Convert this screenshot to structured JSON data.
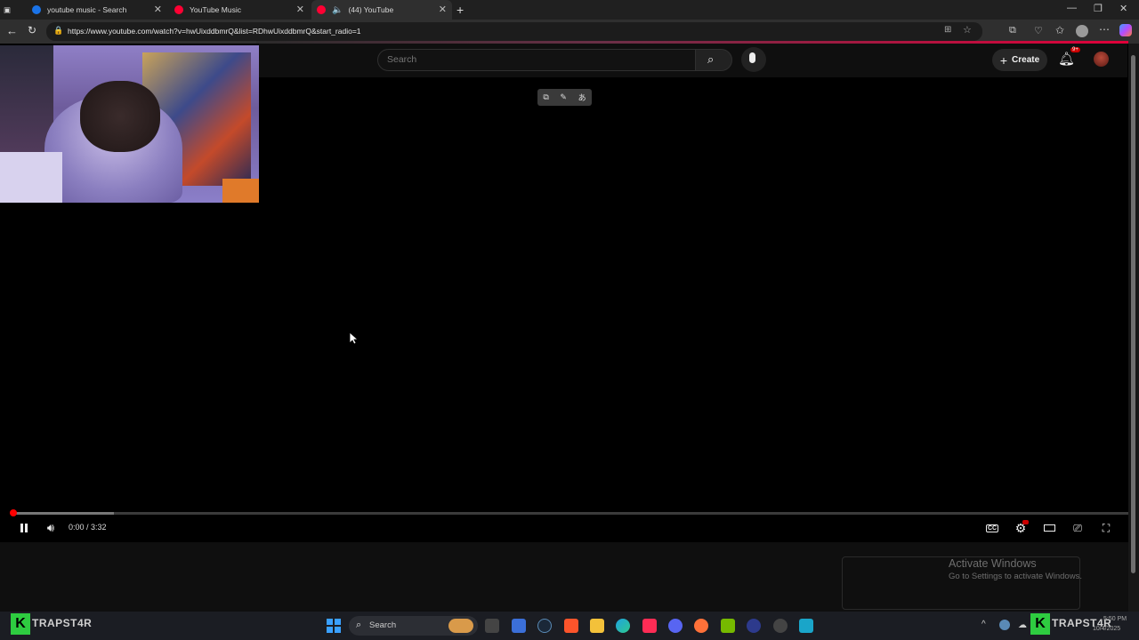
{
  "browser": {
    "tabs": [
      {
        "title": "youtube music - Search"
      },
      {
        "title": "YouTube Music"
      },
      {
        "title": "(44) YouTube"
      }
    ],
    "url": "https://www.youtube.com/watch?v=hwUixddbmrQ&list=RDhwUixddbmrQ&start_radio=1"
  },
  "youtube": {
    "search_placeholder": "Search",
    "create_label": "Create",
    "notification_badge": "9+"
  },
  "player": {
    "time": "0:00 / 3:32",
    "progress_fraction": 0.0
  },
  "watermark": {
    "title": "Activate Windows",
    "subtitle": "Go to Settings to activate Windows."
  },
  "taskbar": {
    "search_label": "Search",
    "brand_left": "TRAPST4R",
    "brand_right": "TRAPST4R",
    "clock_time": "5:50 PM",
    "clock_date": "10/4/2025"
  },
  "colors": {
    "accent_red": "#ff0000",
    "brand_green": "#2ecc40"
  }
}
